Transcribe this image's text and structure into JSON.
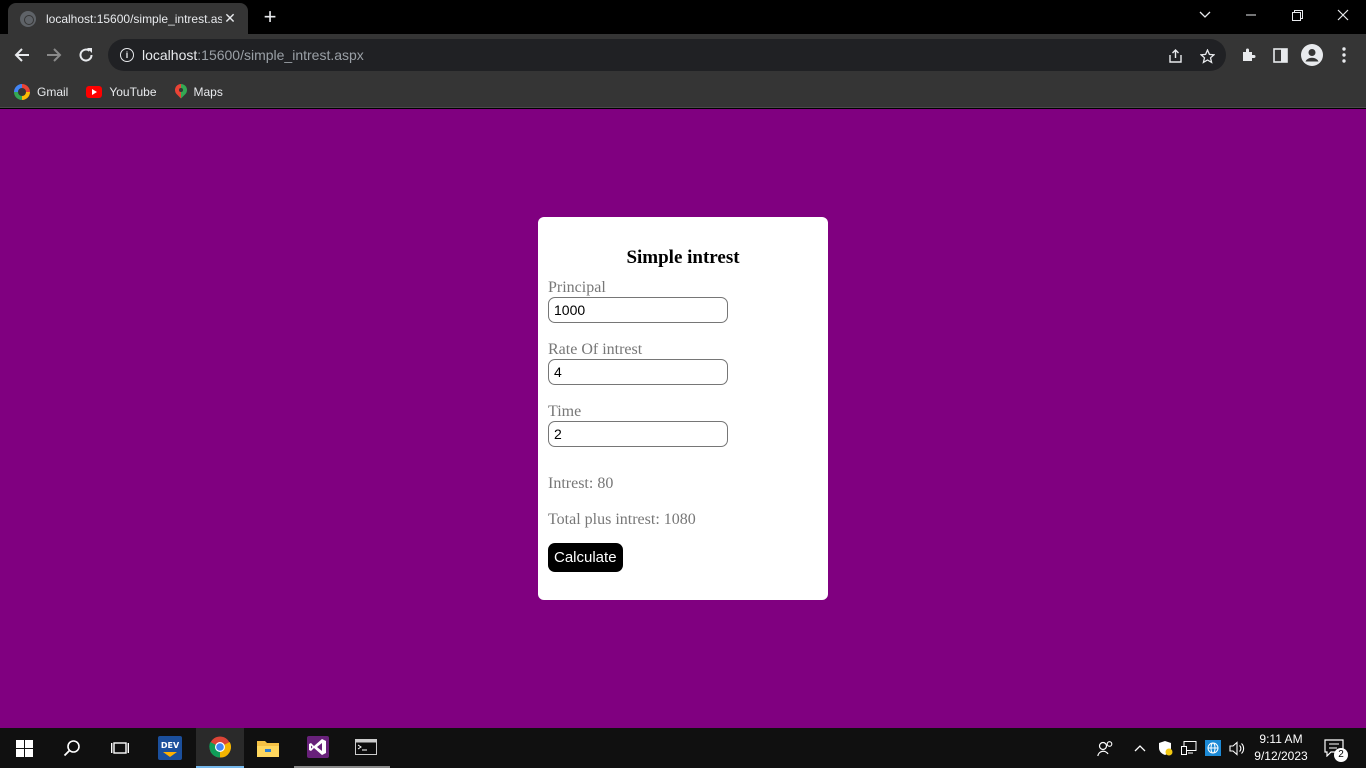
{
  "browser": {
    "tab_title": "localhost:15600/simple_intrest.aspx",
    "tab_close": "✕",
    "new_tab": "+",
    "url_host": "localhost",
    "url_path": ":15600/simple_intrest.aspx",
    "bookmarks": [
      {
        "label": "Gmail",
        "icon": "google-icon"
      },
      {
        "label": "YouTube",
        "icon": "youtube-icon"
      },
      {
        "label": "Maps",
        "icon": "maps-icon"
      }
    ]
  },
  "form": {
    "title": "Simple intrest",
    "principal_label": "Principal",
    "principal_value": "1000",
    "rate_label": "Rate Of intrest",
    "rate_value": "4",
    "time_label": "Time",
    "time_value": "2",
    "interest_result": "Intrest: 80",
    "total_result": "Total plus intrest: 1080",
    "calculate_label": "Calculate"
  },
  "taskbar": {
    "time": "9:11 AM",
    "date": "9/12/2023",
    "notification_count": "2"
  },
  "colors": {
    "page_background": "#800080",
    "card_background": "#ffffff",
    "button_background": "#000000"
  }
}
